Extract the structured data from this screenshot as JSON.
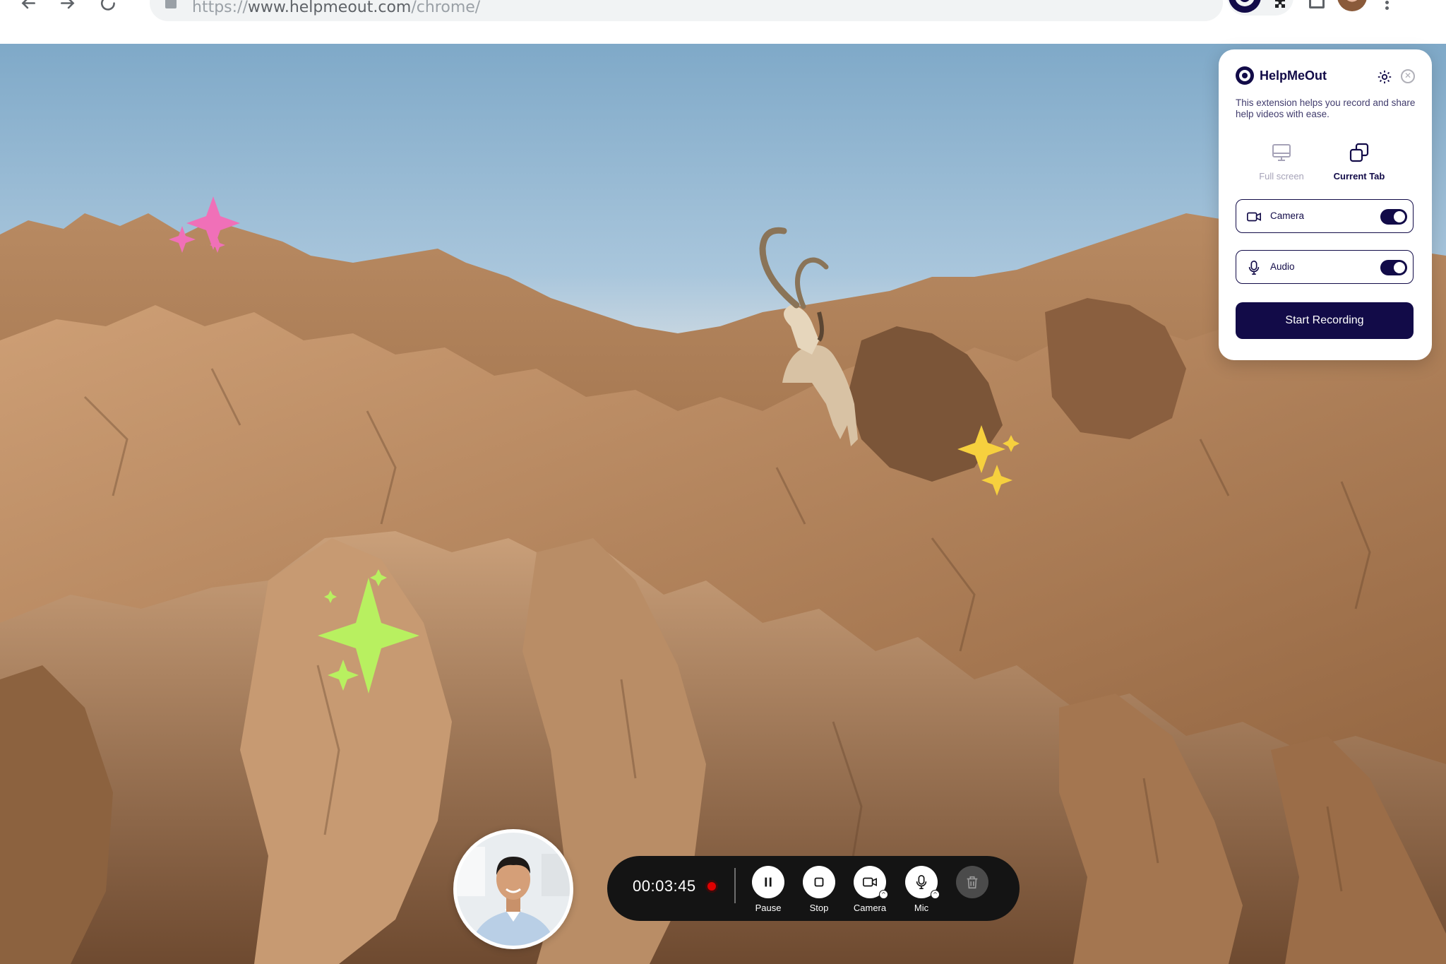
{
  "browser": {
    "url_prefix": "https://",
    "url_host": "www.helpmeout.com",
    "url_path": "/chrome/",
    "icons": [
      "back-arrow-icon",
      "forward-arrow-icon",
      "reload-icon",
      "lock-icon",
      "helpmeout-extension-icon",
      "puzzle-icon",
      "window-icon",
      "profile-avatar",
      "more-menu-icon"
    ]
  },
  "popup": {
    "brand": "HelpMeOut",
    "description": "This extension helps you record and share help videos with ease.",
    "modes": [
      {
        "label": "Full screen",
        "icon": "monitor-icon",
        "active": false
      },
      {
        "label": "Current Tab",
        "icon": "copy-tab-icon",
        "active": true
      }
    ],
    "toggles": [
      {
        "label": "Camera",
        "icon": "video-camera-icon",
        "on": true
      },
      {
        "label": "Audio",
        "icon": "microphone-icon",
        "on": true
      }
    ],
    "start_button": "Start Recording",
    "colors": {
      "primary": "#120b48",
      "muted": "#a6a3b8"
    }
  },
  "recorder": {
    "timer": "00:03:45",
    "recording": true,
    "controls": [
      {
        "label": "Pause",
        "icon": "pause-icon"
      },
      {
        "label": "Stop",
        "icon": "stop-icon"
      },
      {
        "label": "Camera",
        "icon": "video-camera-icon"
      },
      {
        "label": "Mic",
        "icon": "microphone-icon"
      },
      {
        "label": "",
        "icon": "trash-icon"
      }
    ],
    "colors": {
      "bar": "#141414",
      "record": "#e00000"
    }
  }
}
